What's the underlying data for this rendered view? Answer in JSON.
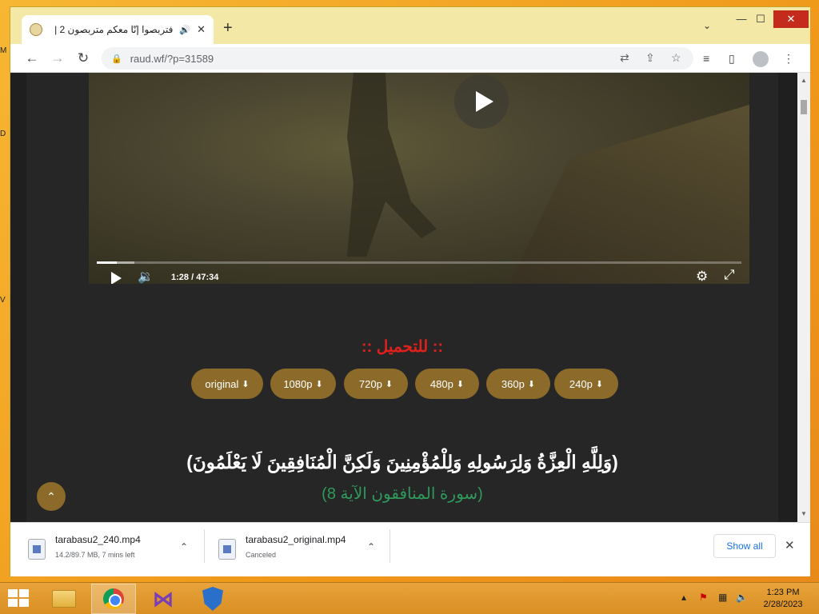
{
  "desktop": {
    "edge_letters": [
      "M",
      "D",
      "V"
    ]
  },
  "browser": {
    "tab": {
      "title": "فتربصوا إنّا معكم متربصون 2 |",
      "audio_icon": "speaker-icon",
      "close_glyph": "✕"
    },
    "new_tab_glyph": "+",
    "tab_search_glyph": "⌄",
    "window_controls": {
      "minimize": "—",
      "maximize": "☐",
      "close": "✕"
    },
    "nav": {
      "back": "←",
      "forward": "→",
      "reload": "↻"
    },
    "url": "raud.wf/?p=31589"
  },
  "video": {
    "time_current": "1:28",
    "time_separator": "/",
    "time_total": "47:34",
    "played_fraction": 0.031,
    "buffered_fraction": 0.058
  },
  "download_section": {
    "title": ":: للتحميل ::",
    "buttons": [
      {
        "label": "original"
      },
      {
        "label": "1080p"
      },
      {
        "label": "720p"
      },
      {
        "label": "480p"
      },
      {
        "label": "360p"
      },
      {
        "label": "240p"
      }
    ]
  },
  "verse": {
    "text": "(وَلِلَّهِ الْعِزَّةُ وَلِرَسُولِهِ وَلِلْمُؤْمِنِينَ وَلَكِنَّ الْمُنَافِقِينَ لَا يَعْلَمُونَ)",
    "reference": "(سورة المنافقون الآية 8)"
  },
  "downloads_bar": {
    "items": [
      {
        "name": "tarabasu2_240.mp4",
        "status": "14.2/89.7 MB, 7 mins left"
      },
      {
        "name": "tarabasu2_original.mp4",
        "status": "Canceled"
      }
    ],
    "show_all": "Show all"
  },
  "taskbar": {
    "time": "1:23 PM",
    "date": "2/28/2023"
  },
  "colors": {
    "accent_brown": "#8c6a2a",
    "download_title_red": "#e0201b",
    "verse_ref_green": "#2e9a5c",
    "page_bg": "#262626"
  }
}
